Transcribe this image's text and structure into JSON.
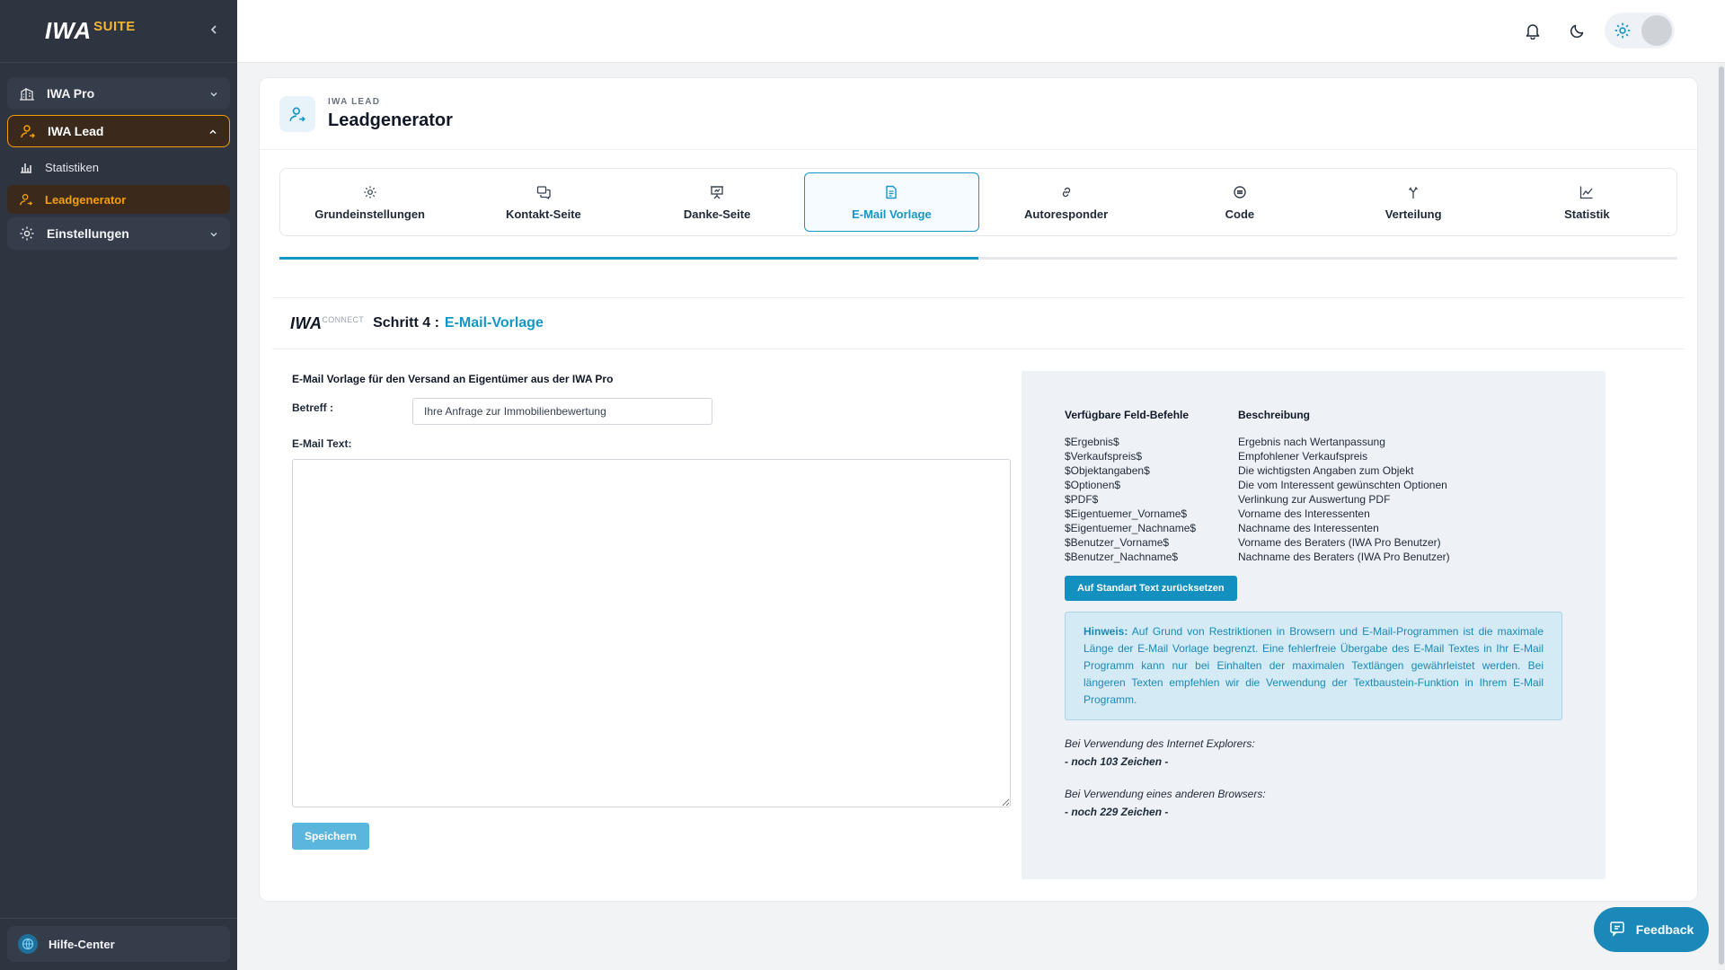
{
  "app": {
    "logo_main": "IWA",
    "logo_suite": "SUITE"
  },
  "sidebar": {
    "items": [
      {
        "label": "IWA Pro",
        "icon": "building-icon"
      },
      {
        "label": "IWA Lead",
        "icon": "user-lead-icon"
      },
      {
        "label": "Statistiken",
        "icon": "bar-chart-icon"
      },
      {
        "label": "Leadgenerator",
        "icon": "user-lead-icon"
      },
      {
        "label": "Einstellungen",
        "icon": "gear-icon"
      }
    ],
    "help_label": "Hilfe-Center"
  },
  "header": {
    "eyebrow": "IWA LEAD",
    "title": "Leadgenerator"
  },
  "tabs": [
    {
      "label": "Grundeinstellungen",
      "icon": "gear-icon"
    },
    {
      "label": "Kontakt-Seite",
      "icon": "chat-icon"
    },
    {
      "label": "Danke-Seite",
      "icon": "presentation-icon"
    },
    {
      "label": "E-Mail Vorlage",
      "icon": "document-icon"
    },
    {
      "label": "Autoresponder",
      "icon": "link-icon"
    },
    {
      "label": "Code",
      "icon": "code-icon"
    },
    {
      "label": "Verteilung",
      "icon": "split-arrows-icon"
    },
    {
      "label": "Statistik",
      "icon": "line-chart-icon"
    }
  ],
  "progress": {
    "percent": 50
  },
  "step": {
    "brand_main": "IWA",
    "brand_sub": "CONNECT",
    "label": "Schritt 4 :",
    "name": "E-Mail-Vorlage"
  },
  "form": {
    "title": "E-Mail Vorlage für den Versand an Eigentümer aus der IWA Pro",
    "subject_label": "Betreff :",
    "subject_value": "Ihre Anfrage zur Immobilienbewertung",
    "body_label": "E-Mail Text:",
    "body_value": "",
    "save_label": "Speichern"
  },
  "panel": {
    "col1_header": "Verfügbare Feld-Befehle",
    "col2_header": "Beschreibung",
    "rows": [
      {
        "cmd": "$Ergebnis$",
        "desc": "Ergebnis nach Wertanpassung"
      },
      {
        "cmd": "$Verkaufspreis$",
        "desc": "Empfohlener Verkaufspreis"
      },
      {
        "cmd": "$Objektangaben$",
        "desc": "Die wichtigsten Angaben zum Objekt"
      },
      {
        "cmd": "$Optionen$",
        "desc": "Die vom Interessent gewünschten Optionen"
      },
      {
        "cmd": "$PDF$",
        "desc": "Verlinkung zur Auswertung PDF"
      },
      {
        "cmd": "$Eigentuemer_Vorname$",
        "desc": "Vorname des Interessenten"
      },
      {
        "cmd": "$Eigentuemer_Nachname$",
        "desc": "Nachname des Interessenten"
      },
      {
        "cmd": "$Benutzer_Vorname$",
        "desc": "Vorname des Beraters (IWA Pro Benutzer)"
      },
      {
        "cmd": "$Benutzer_Nachname$",
        "desc": "Nachname des Beraters (IWA Pro Benutzer)"
      }
    ],
    "reset_label": "Auf Standart Text zurücksetzen",
    "hint_label": "Hinweis:",
    "hint_text": "Auf Grund von Restriktionen in Browsern und E-Mail-Programmen ist die maximale Länge der E-Mail Vorlage begrenzt. Eine fehlerfreie Übergabe des E-Mail Textes in Ihr E-Mail Programm kann nur bei Einhalten der maximalen Textlängen gewährleistet werden. Bei längeren Texten empfehlen wir die Verwendung der Textbaustein-Funktion in Ihrem E-Mail Programm.",
    "ie_label": "Bei Verwendung des Internet Explorers:",
    "ie_count": "- noch 103 Zeichen -",
    "other_label": "Bei Verwendung eines anderen Browsers:",
    "other_count": "- noch 229 Zeichen -"
  },
  "feedback_label": "Feedback",
  "colors": {
    "accent": "#1496c7",
    "sidebar_bg": "#2e3541",
    "lead_orange": "#f59e0b"
  }
}
